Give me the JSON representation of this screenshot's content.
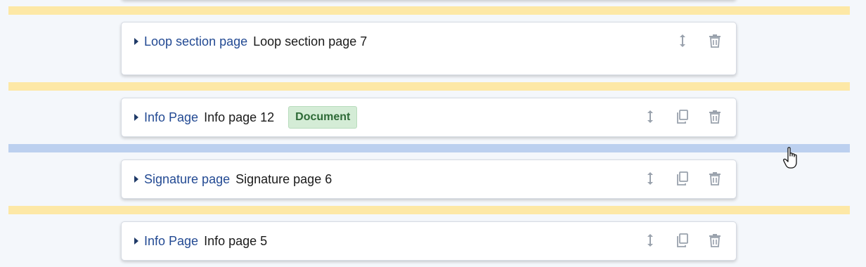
{
  "pages": [
    {
      "type_label": "Loop section page",
      "title": "Loop section page 7",
      "badge": ""
    },
    {
      "type_label": "Info Page",
      "title": "Info page 12",
      "badge": "Document"
    },
    {
      "type_label": "Signature page",
      "title": "Signature page 6",
      "badge": ""
    },
    {
      "type_label": "Info Page",
      "title": "Info page 5",
      "badge": ""
    }
  ],
  "icons": {
    "expand": "caret-right-icon",
    "move": "reorder-arrows-icon",
    "duplicate": "copy-icon",
    "delete": "trash-icon",
    "cursor": "hand-pointer-icon"
  },
  "colors": {
    "drop_zone": "#fde8a6",
    "drop_zone_active": "#bcd0ef",
    "type_label": "#234a93",
    "badge_bg": "#d4ecd6",
    "badge_text": "#2e6a37"
  }
}
